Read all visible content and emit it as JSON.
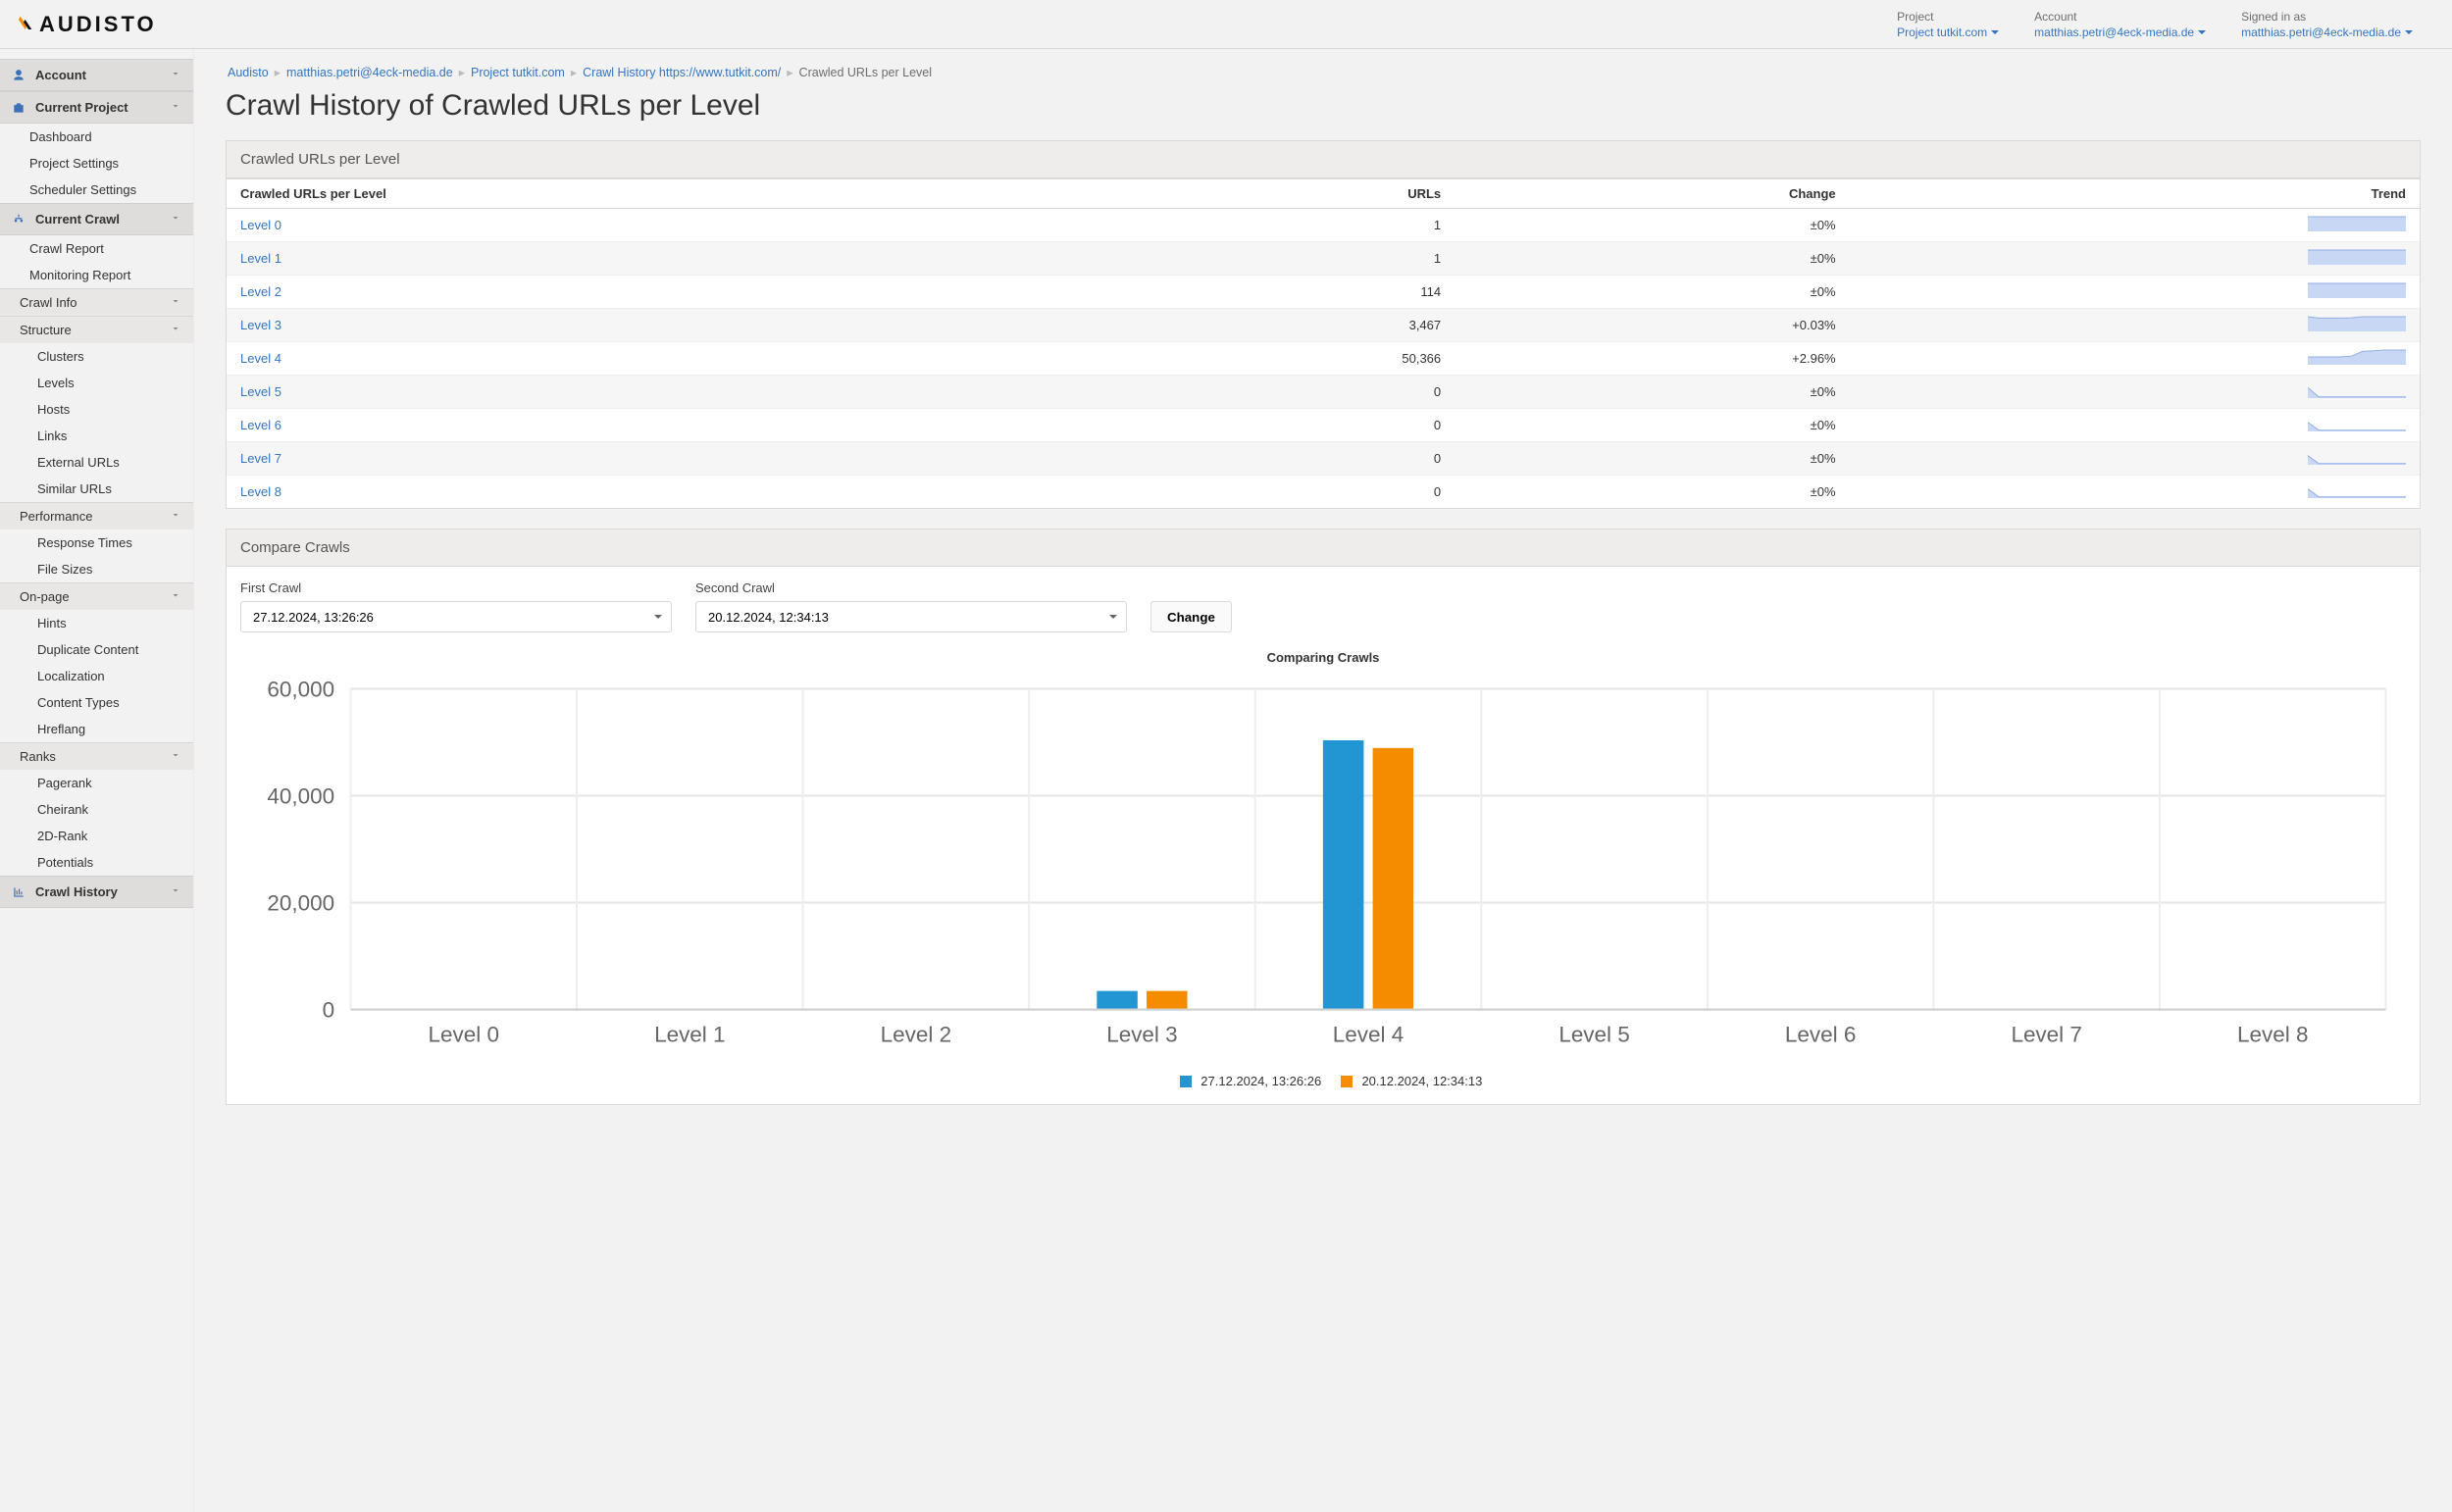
{
  "brand": "AUDISTO",
  "topbar": {
    "project_label": "Project",
    "project_value": "Project tutkit.com",
    "account_label": "Account",
    "account_value": "matthias.petri@4eck-media.de",
    "signedin_label": "Signed in as",
    "signedin_value": "matthias.petri@4eck-media.de"
  },
  "breadcrumb": {
    "items": [
      {
        "label": "Audisto",
        "link": true
      },
      {
        "label": "matthias.petri@4eck-media.de",
        "link": true
      },
      {
        "label": "Project tutkit.com",
        "link": true
      },
      {
        "label": "Crawl History https://www.tutkit.com/",
        "link": true
      },
      {
        "label": "Crawled URLs per Level",
        "link": false
      }
    ]
  },
  "page_title": "Crawl History of Crawled URLs per Level",
  "sidebar": {
    "account": "Account",
    "current_project": "Current Project",
    "project_items": [
      "Dashboard",
      "Project Settings",
      "Scheduler Settings"
    ],
    "current_crawl": "Current Crawl",
    "crawl_top": [
      "Crawl Report",
      "Monitoring Report"
    ],
    "crawl_info": "Crawl Info",
    "structure": "Structure",
    "structure_items": [
      "Clusters",
      "Levels",
      "Hosts",
      "Links",
      "External URLs",
      "Similar URLs"
    ],
    "performance": "Performance",
    "performance_items": [
      "Response Times",
      "File Sizes"
    ],
    "onpage": "On-page",
    "onpage_items": [
      "Hints",
      "Duplicate Content",
      "Localization",
      "Content Types",
      "Hreflang"
    ],
    "ranks": "Ranks",
    "ranks_items": [
      "Pagerank",
      "Cheirank",
      "2D-Rank",
      "Potentials"
    ],
    "crawl_history": "Crawl History"
  },
  "table_panel": {
    "title": "Crawled URLs per Level",
    "headers": [
      "Crawled URLs per Level",
      "URLs",
      "Change",
      "Trend"
    ],
    "rows": [
      {
        "level": "Level 0",
        "urls": "1",
        "change": "±0%",
        "spark": [
          1,
          1,
          1,
          1,
          1,
          1,
          1,
          1,
          1,
          1
        ]
      },
      {
        "level": "Level 1",
        "urls": "1",
        "change": "±0%",
        "spark": [
          1,
          1,
          1,
          1,
          1,
          1,
          1,
          1,
          1,
          1
        ]
      },
      {
        "level": "Level 2",
        "urls": "114",
        "change": "±0%",
        "spark": [
          1,
          1,
          1,
          1,
          1,
          1,
          1,
          1,
          1,
          1
        ]
      },
      {
        "level": "Level 3",
        "urls": "3,467",
        "change": "+0.03%",
        "spark": [
          1,
          0.9,
          0.9,
          0.9,
          0.92,
          1,
          1,
          1,
          1,
          1
        ]
      },
      {
        "level": "Level 4",
        "urls": "50,366",
        "change": "+2.96%",
        "spark": [
          0.5,
          0.5,
          0.5,
          0.5,
          0.55,
          0.9,
          0.95,
          1,
          1,
          1
        ]
      },
      {
        "level": "Level 5",
        "urls": "0",
        "change": "±0%",
        "spark": [
          0.7,
          0.02,
          0.02,
          0.02,
          0.02,
          0.02,
          0.02,
          0.02,
          0.02,
          0.02
        ]
      },
      {
        "level": "Level 6",
        "urls": "0",
        "change": "±0%",
        "spark": [
          0.6,
          0.02,
          0.02,
          0.02,
          0.02,
          0.02,
          0.02,
          0.02,
          0.02,
          0.02
        ]
      },
      {
        "level": "Level 7",
        "urls": "0",
        "change": "±0%",
        "spark": [
          0.6,
          0.02,
          0.02,
          0.02,
          0.02,
          0.02,
          0.02,
          0.02,
          0.02,
          0.02
        ]
      },
      {
        "level": "Level 8",
        "urls": "0",
        "change": "±0%",
        "spark": [
          0.6,
          0.02,
          0.02,
          0.02,
          0.02,
          0.02,
          0.02,
          0.02,
          0.02,
          0.02
        ]
      }
    ]
  },
  "compare_panel": {
    "title": "Compare Crawls",
    "first_label": "First Crawl",
    "second_label": "Second Crawl",
    "first_value": "27.12.2024, 13:26:26",
    "second_value": "20.12.2024, 12:34:13",
    "change_button": "Change"
  },
  "chart_data": {
    "type": "bar",
    "title": "Comparing Crawls",
    "ylabel": "",
    "xlabel": "",
    "ylim": [
      0,
      60000
    ],
    "yticks": [
      0,
      20000,
      40000,
      60000
    ],
    "categories": [
      "Level 0",
      "Level 1",
      "Level 2",
      "Level 3",
      "Level 4",
      "Level 5",
      "Level 6",
      "Level 7",
      "Level 8"
    ],
    "series": [
      {
        "name": "27.12.2024, 13:26:26",
        "color": "#2196d3",
        "values": [
          1,
          1,
          114,
          3467,
          50366,
          0,
          0,
          0,
          0
        ]
      },
      {
        "name": "20.12.2024, 12:34:13",
        "color": "#f58c00",
        "values": [
          1,
          1,
          114,
          3466,
          48918,
          0,
          0,
          0,
          0
        ]
      }
    ]
  }
}
